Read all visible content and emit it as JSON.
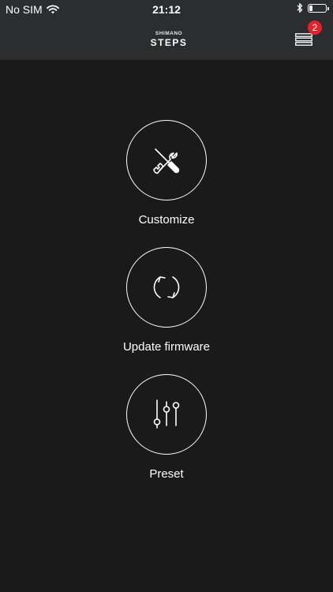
{
  "status_bar": {
    "carrier": "No SIM",
    "time": "21:12",
    "battery_level": 0.2
  },
  "header": {
    "logo_top": "SHIMANO",
    "logo_main": "STEPS",
    "menu_badge": "2"
  },
  "menu_items": [
    {
      "label": "Customize",
      "icon": "wrench-screwdriver-icon"
    },
    {
      "label": "Update firmware",
      "icon": "refresh-arrows-icon"
    },
    {
      "label": "Preset",
      "icon": "sliders-icon"
    }
  ],
  "colors": {
    "background": "#1a1a1a",
    "header": "#2b2d2f",
    "badge": "#e8202a",
    "text": "#ffffff"
  }
}
